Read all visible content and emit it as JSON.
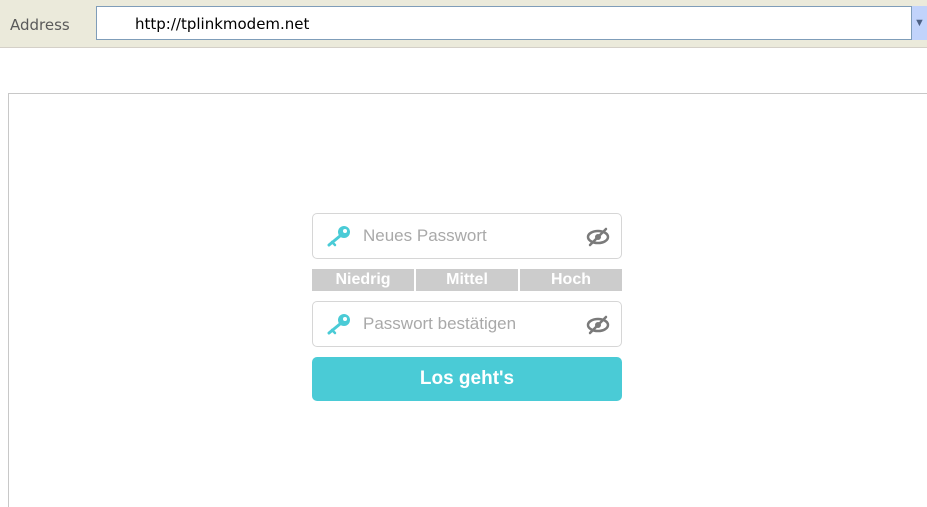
{
  "browser": {
    "address_label": "Address",
    "url": "http://tplinkmodem.net",
    "dropdown_glyph": "▼"
  },
  "form": {
    "new_password": {
      "placeholder": "Neues Passwort",
      "value": "",
      "icon": "key-icon",
      "toggle_icon": "eye-slash-icon"
    },
    "strength": {
      "low": "Niedrig",
      "medium": "Mittel",
      "high": "Hoch"
    },
    "confirm_password": {
      "placeholder": "Passwort bestätigen",
      "value": "",
      "icon": "key-icon",
      "toggle_icon": "eye-slash-icon"
    },
    "submit_label": "Los geht's"
  },
  "colors": {
    "accent": "#4acbd6",
    "strength_inactive": "#cccccc",
    "field_border": "#d6d6d6",
    "placeholder": "#a9a9a9"
  }
}
